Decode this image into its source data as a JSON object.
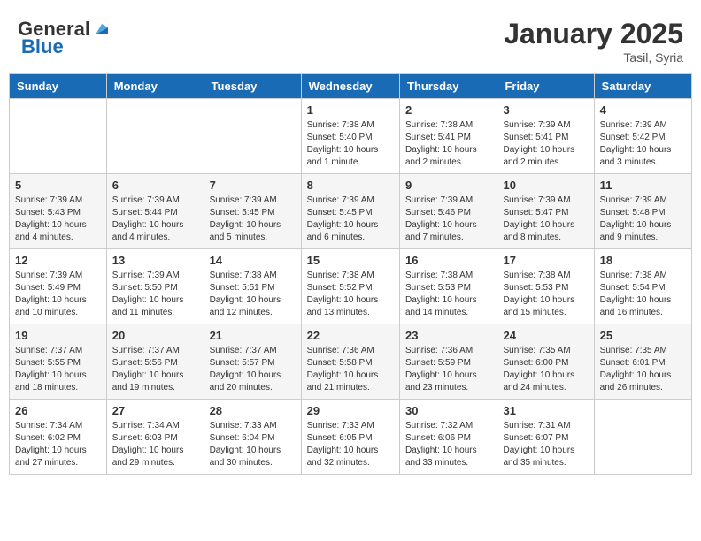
{
  "header": {
    "logo_general": "General",
    "logo_blue": "Blue",
    "month_year": "January 2025",
    "location": "Tasil, Syria"
  },
  "days_of_week": [
    "Sunday",
    "Monday",
    "Tuesday",
    "Wednesday",
    "Thursday",
    "Friday",
    "Saturday"
  ],
  "weeks": [
    {
      "days": [
        {
          "num": "",
          "info": ""
        },
        {
          "num": "",
          "info": ""
        },
        {
          "num": "",
          "info": ""
        },
        {
          "num": "1",
          "info": "Sunrise: 7:38 AM\nSunset: 5:40 PM\nDaylight: 10 hours\nand 1 minute."
        },
        {
          "num": "2",
          "info": "Sunrise: 7:38 AM\nSunset: 5:41 PM\nDaylight: 10 hours\nand 2 minutes."
        },
        {
          "num": "3",
          "info": "Sunrise: 7:39 AM\nSunset: 5:41 PM\nDaylight: 10 hours\nand 2 minutes."
        },
        {
          "num": "4",
          "info": "Sunrise: 7:39 AM\nSunset: 5:42 PM\nDaylight: 10 hours\nand 3 minutes."
        }
      ]
    },
    {
      "days": [
        {
          "num": "5",
          "info": "Sunrise: 7:39 AM\nSunset: 5:43 PM\nDaylight: 10 hours\nand 4 minutes."
        },
        {
          "num": "6",
          "info": "Sunrise: 7:39 AM\nSunset: 5:44 PM\nDaylight: 10 hours\nand 4 minutes."
        },
        {
          "num": "7",
          "info": "Sunrise: 7:39 AM\nSunset: 5:45 PM\nDaylight: 10 hours\nand 5 minutes."
        },
        {
          "num": "8",
          "info": "Sunrise: 7:39 AM\nSunset: 5:45 PM\nDaylight: 10 hours\nand 6 minutes."
        },
        {
          "num": "9",
          "info": "Sunrise: 7:39 AM\nSunset: 5:46 PM\nDaylight: 10 hours\nand 7 minutes."
        },
        {
          "num": "10",
          "info": "Sunrise: 7:39 AM\nSunset: 5:47 PM\nDaylight: 10 hours\nand 8 minutes."
        },
        {
          "num": "11",
          "info": "Sunrise: 7:39 AM\nSunset: 5:48 PM\nDaylight: 10 hours\nand 9 minutes."
        }
      ]
    },
    {
      "days": [
        {
          "num": "12",
          "info": "Sunrise: 7:39 AM\nSunset: 5:49 PM\nDaylight: 10 hours\nand 10 minutes."
        },
        {
          "num": "13",
          "info": "Sunrise: 7:39 AM\nSunset: 5:50 PM\nDaylight: 10 hours\nand 11 minutes."
        },
        {
          "num": "14",
          "info": "Sunrise: 7:38 AM\nSunset: 5:51 PM\nDaylight: 10 hours\nand 12 minutes."
        },
        {
          "num": "15",
          "info": "Sunrise: 7:38 AM\nSunset: 5:52 PM\nDaylight: 10 hours\nand 13 minutes."
        },
        {
          "num": "16",
          "info": "Sunrise: 7:38 AM\nSunset: 5:53 PM\nDaylight: 10 hours\nand 14 minutes."
        },
        {
          "num": "17",
          "info": "Sunrise: 7:38 AM\nSunset: 5:53 PM\nDaylight: 10 hours\nand 15 minutes."
        },
        {
          "num": "18",
          "info": "Sunrise: 7:38 AM\nSunset: 5:54 PM\nDaylight: 10 hours\nand 16 minutes."
        }
      ]
    },
    {
      "days": [
        {
          "num": "19",
          "info": "Sunrise: 7:37 AM\nSunset: 5:55 PM\nDaylight: 10 hours\nand 18 minutes."
        },
        {
          "num": "20",
          "info": "Sunrise: 7:37 AM\nSunset: 5:56 PM\nDaylight: 10 hours\nand 19 minutes."
        },
        {
          "num": "21",
          "info": "Sunrise: 7:37 AM\nSunset: 5:57 PM\nDaylight: 10 hours\nand 20 minutes."
        },
        {
          "num": "22",
          "info": "Sunrise: 7:36 AM\nSunset: 5:58 PM\nDaylight: 10 hours\nand 21 minutes."
        },
        {
          "num": "23",
          "info": "Sunrise: 7:36 AM\nSunset: 5:59 PM\nDaylight: 10 hours\nand 23 minutes."
        },
        {
          "num": "24",
          "info": "Sunrise: 7:35 AM\nSunset: 6:00 PM\nDaylight: 10 hours\nand 24 minutes."
        },
        {
          "num": "25",
          "info": "Sunrise: 7:35 AM\nSunset: 6:01 PM\nDaylight: 10 hours\nand 26 minutes."
        }
      ]
    },
    {
      "days": [
        {
          "num": "26",
          "info": "Sunrise: 7:34 AM\nSunset: 6:02 PM\nDaylight: 10 hours\nand 27 minutes."
        },
        {
          "num": "27",
          "info": "Sunrise: 7:34 AM\nSunset: 6:03 PM\nDaylight: 10 hours\nand 29 minutes."
        },
        {
          "num": "28",
          "info": "Sunrise: 7:33 AM\nSunset: 6:04 PM\nDaylight: 10 hours\nand 30 minutes."
        },
        {
          "num": "29",
          "info": "Sunrise: 7:33 AM\nSunset: 6:05 PM\nDaylight: 10 hours\nand 32 minutes."
        },
        {
          "num": "30",
          "info": "Sunrise: 7:32 AM\nSunset: 6:06 PM\nDaylight: 10 hours\nand 33 minutes."
        },
        {
          "num": "31",
          "info": "Sunrise: 7:31 AM\nSunset: 6:07 PM\nDaylight: 10 hours\nand 35 minutes."
        },
        {
          "num": "",
          "info": ""
        }
      ]
    }
  ]
}
